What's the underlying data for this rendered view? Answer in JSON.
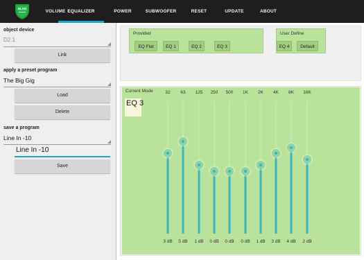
{
  "nav": {
    "items": [
      "VOLUME",
      "EQUALIZER",
      "POWER",
      "SUBWOOFER",
      "RESET",
      "UPDATE",
      "ABOUT"
    ],
    "active": "EQUALIZER",
    "logo_text": "BLAM"
  },
  "left": {
    "object_device_label": "object device",
    "object_device_value": "D2.1",
    "link_button": "Link",
    "preset_label": "apply a preset program",
    "preset_value": "The Big Gig",
    "load_button": "Load",
    "delete_button": "Delete",
    "save_label": "save a program",
    "save_select_value": "Line In -10",
    "save_input_value": "Line In -10",
    "save_button": "Save"
  },
  "presets": {
    "provided_label": "Provided",
    "provided_buttons": [
      "EQ Flat",
      "EQ 1",
      "EQ 2",
      "EQ 3"
    ],
    "user_label": "User Define",
    "user_buttons": [
      "EQ 4",
      "Default"
    ]
  },
  "eq": {
    "current_mode_label": "Current Mode",
    "current_mode": "EQ 3",
    "bands": [
      {
        "freq": "32",
        "gain_label": "3 dB",
        "gain": 3
      },
      {
        "freq": "63",
        "gain_label": "5 dB",
        "gain": 5
      },
      {
        "freq": "125",
        "gain_label": "1 dB",
        "gain": 1
      },
      {
        "freq": "250",
        "gain_label": "0 dB",
        "gain": 0
      },
      {
        "freq": "500",
        "gain_label": "0 dB",
        "gain": 0
      },
      {
        "freq": "1K",
        "gain_label": "0 dB",
        "gain": 0
      },
      {
        "freq": "2K",
        "gain_label": "1 dB",
        "gain": 1
      },
      {
        "freq": "4K",
        "gain_label": "3 dB",
        "gain": 3
      },
      {
        "freq": "8K",
        "gain_label": "4 dB",
        "gain": 4
      },
      {
        "freq": "16K",
        "gain_label": "2 dB",
        "gain": 2
      }
    ]
  },
  "colors": {
    "accent": "#1aa6c8",
    "eq_green": "#b9e29a",
    "track": "#3bb5c2",
    "topbar": "#1e1e1e"
  }
}
